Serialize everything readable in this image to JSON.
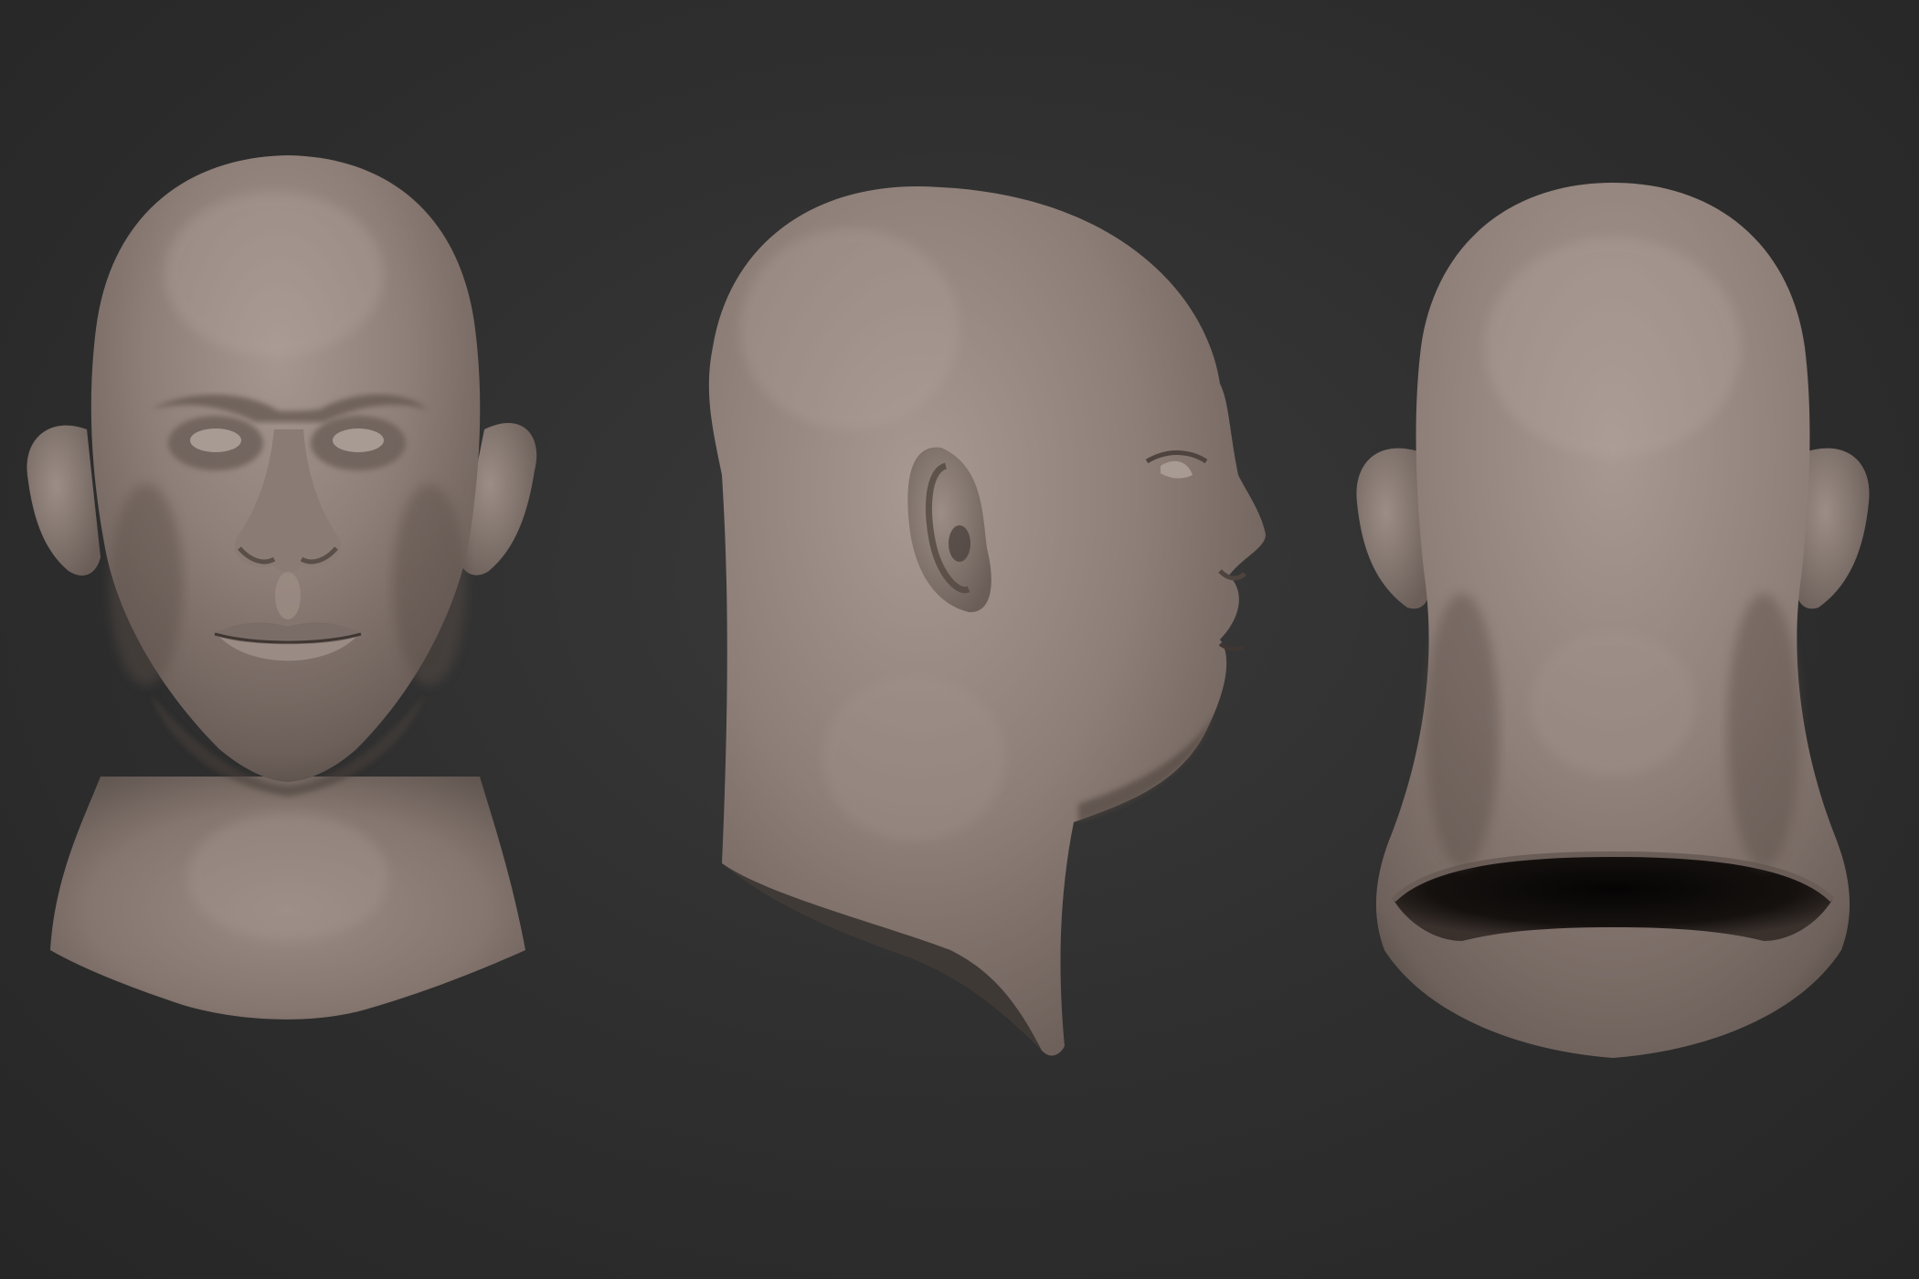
{
  "scene": {
    "background_color": "#2e2e2e",
    "material_color": "#8f8079",
    "views": [
      {
        "view": "front",
        "icon": "head-front-icon"
      },
      {
        "view": "side",
        "icon": "head-profile-icon"
      },
      {
        "view": "back",
        "icon": "head-back-icon"
      }
    ]
  }
}
